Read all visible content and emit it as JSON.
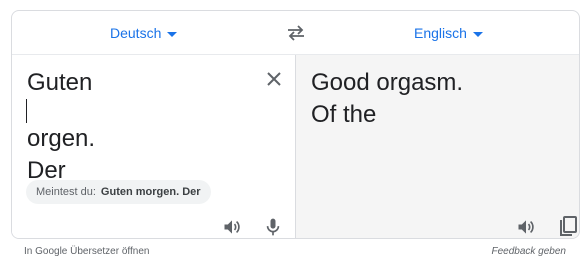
{
  "source_language": "Deutsch",
  "target_language": "Englisch",
  "source": {
    "lines": [
      "Guten ",
      "orgen.",
      "Der"
    ]
  },
  "suggestion": {
    "prefix": "Meintest du:",
    "text": "Guten morgen. Der"
  },
  "target": {
    "lines": [
      "Good orgasm.",
      "Of the"
    ]
  },
  "footer": {
    "open_link": "In Google Übersetzer öffnen",
    "feedback": "Feedback geben"
  },
  "icons": {
    "swap": "swap-arrows-icon",
    "clear": "close-icon",
    "source_speaker": "speaker-icon",
    "mic": "microphone-icon",
    "target_speaker": "speaker-icon",
    "copy": "copy-icon"
  },
  "colors": {
    "accent": "#1a73e8",
    "icon": "#5f6368",
    "target_bg": "#f5f5f5"
  }
}
